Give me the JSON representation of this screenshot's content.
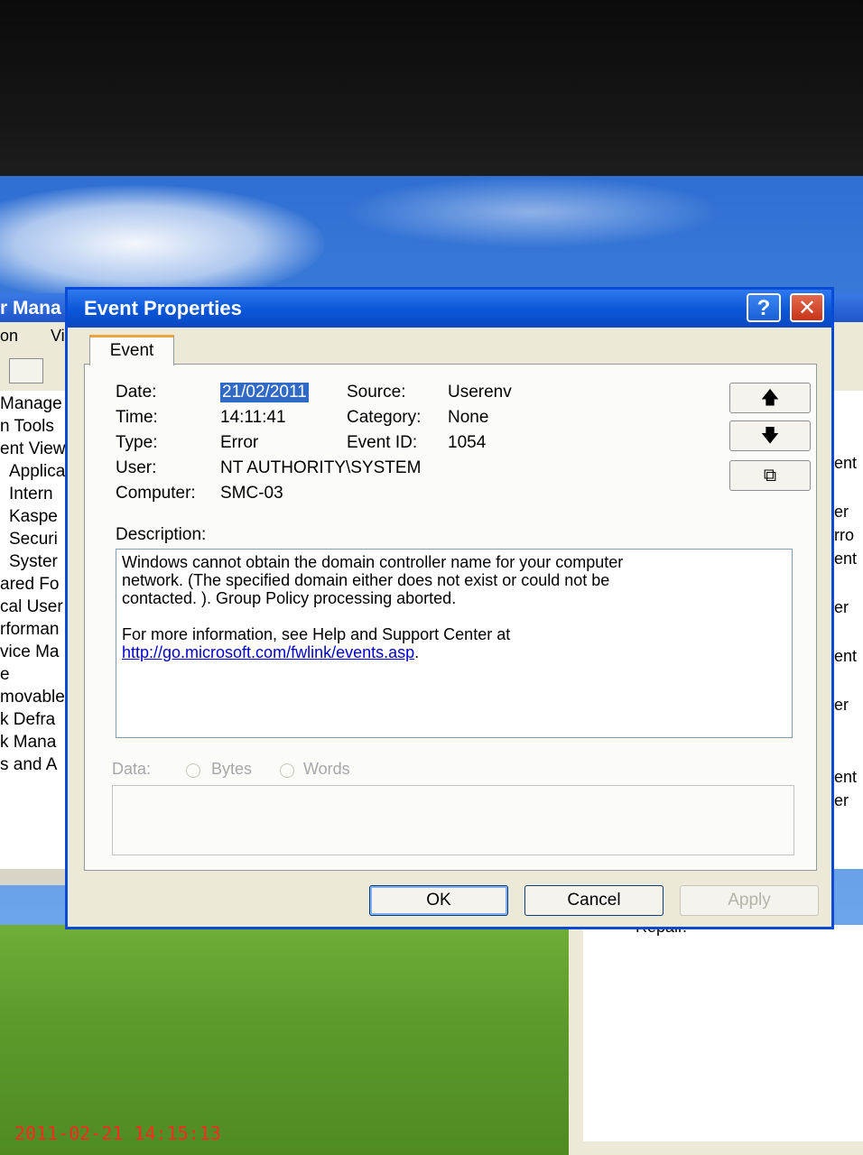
{
  "background": {
    "window_title_fragment": "r Mana",
    "menu_fragments": [
      "on",
      "Vi"
    ],
    "tree_items": [
      "Manage",
      "n Tools",
      "ent View",
      "Applica",
      "Intern",
      "Kaspe",
      "Securi",
      "Syster",
      "ared Fo",
      "cal User",
      "rforman",
      "vice Ma",
      "e",
      "movable",
      "k Defra",
      "k Mana",
      "s and A"
    ],
    "right_column": [
      "ent",
      "er",
      "rro",
      "ent",
      "er",
      "ent",
      "er",
      "ent",
      "er"
    ],
    "bottom_fragment": "Repair."
  },
  "dialog": {
    "title": "Event Properties",
    "help_button": "?",
    "close_button": "✕",
    "tab": "Event",
    "fields": {
      "date_label": "Date:",
      "date_value": "21/02/2011",
      "source_label": "Source:",
      "source_value": "Userenv",
      "time_label": "Time:",
      "time_value": "14:11:41",
      "category_label": "Category:",
      "category_value": "None",
      "type_label": "Type:",
      "type_value": "Error",
      "eventid_label": "Event ID:",
      "eventid_value": "1054",
      "user_label": "User:",
      "user_value": "NT AUTHORITY\\SYSTEM",
      "computer_label": "Computer:",
      "computer_value": "SMC-03"
    },
    "nav": {
      "up": "🡅",
      "down": "🡇",
      "copy": "⧉"
    },
    "description_label": "Description:",
    "description_line1": "Windows cannot obtain the domain controller name for your computer",
    "description_line2": "network. (The specified domain either does not exist or could not be",
    "description_line3": "contacted. ). Group Policy processing aborted.",
    "more_info": "For more information, see Help and Support Center at",
    "link": "http://go.microsoft.com/fwlink/events.asp",
    "link_suffix": ".",
    "data_label": "Data:",
    "bytes_label": "Bytes",
    "words_label": "Words",
    "buttons": {
      "ok": "OK",
      "cancel": "Cancel",
      "apply": "Apply"
    }
  },
  "timestamp": "2011-02-21 14:15:13"
}
